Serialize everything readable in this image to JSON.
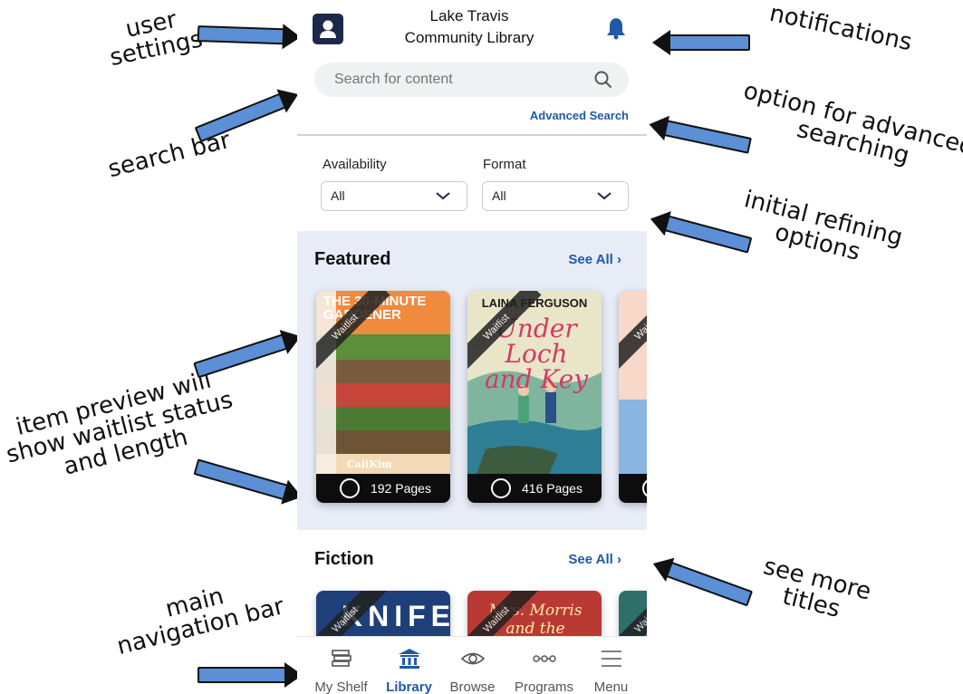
{
  "header": {
    "title_line1": "Lake Travis",
    "title_line2": "Community Library"
  },
  "search": {
    "placeholder": "Search for content",
    "advanced_label": "Advanced Search"
  },
  "filters": [
    {
      "label": "Availability",
      "value": "All"
    },
    {
      "label": "Format",
      "value": "All"
    }
  ],
  "sections": [
    {
      "title": "Featured",
      "see_all": "See All"
    },
    {
      "title": "Fiction",
      "see_all": "See All"
    }
  ],
  "featured_books": [
    {
      "status": "Waitlist",
      "pages": "192 Pages",
      "title": "THE 30-MINUTE GARDENER",
      "author": "CaliKim"
    },
    {
      "status": "Waitlist",
      "pages": "416 Pages",
      "title": "Under Loch and Key",
      "author": "LAINA FERGUSON"
    },
    {
      "status": "Waitlist",
      "pages": ""
    }
  ],
  "fiction_books": [
    {
      "status": "Waitlist",
      "title": "KNIFE"
    },
    {
      "status": "Waitlist",
      "title": "Mrs. Morris and the"
    },
    {
      "status": "Waitlist"
    }
  ],
  "nav": [
    {
      "label": "My Shelf",
      "icon": "shelf-icon",
      "active": false
    },
    {
      "label": "Library",
      "icon": "library-icon",
      "active": true
    },
    {
      "label": "Browse",
      "icon": "eye-icon",
      "active": false
    },
    {
      "label": "Programs",
      "icon": "programs-icon",
      "active": false
    },
    {
      "label": "Menu",
      "icon": "menu-icon",
      "active": false
    }
  ],
  "annotations": {
    "user_settings": "user\nsettings",
    "notifications": "notifications",
    "search_bar": "search bar",
    "advanced": "option for advanced\nsearching",
    "refining": "initial refining\noptions",
    "preview": "item preview will\nshow waitlist status\nand length",
    "see_more": "see more\ntitles",
    "main_nav": "main\nnavigation bar"
  },
  "colors": {
    "accent": "#1e5aa8",
    "active_nav": "#1e5aa8",
    "arrow": "#5b8fd6",
    "featured_bg": "#e7ecf7"
  }
}
